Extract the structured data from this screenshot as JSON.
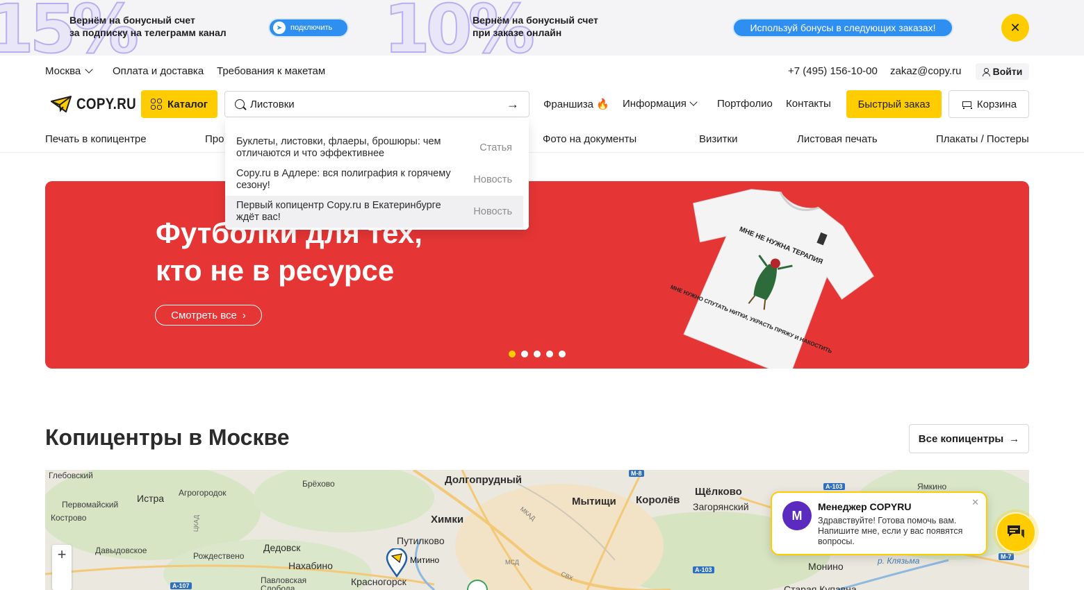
{
  "promo": {
    "big1": "15%",
    "text1_line1": "Вернём на бонусный счет",
    "text1_line2": "за подписку на телеграмм канал",
    "connect_label": "подключить",
    "big2": "10%",
    "text2_line1": "Вернём на бонусный счет",
    "text2_line2": "при заказе онлайн",
    "bonus_label": "Используй бонусы в следующих заказах!",
    "close_glyph": "✕"
  },
  "topbar": {
    "city": "Москва",
    "links": [
      "Оплата и доставка",
      "Требования к макетам"
    ],
    "phone": "+7 (495) 156-10-00",
    "email": "zakaz@copy.ru",
    "login": "Войти"
  },
  "header": {
    "logo": "COPY.RU",
    "catalog": "Каталог",
    "search_value": "Листовки",
    "nav": [
      "Франшиза 🔥",
      "Информация",
      "Портфолио",
      "Контакты"
    ],
    "fast_order": "Быстрый заказ",
    "cart": "Корзина"
  },
  "categories": [
    "Печать в копицентре",
    "Про",
    "Фото на документы",
    "Визитки",
    "Листовая печать",
    "Плакаты / Постеры"
  ],
  "search_results": [
    {
      "title": "Буклеты, листовки, флаеры, брошюры: чем отличаются и что эффективнее",
      "kind": "Статья"
    },
    {
      "title": "Copy.ru в Адлере: вся полиграфия к горячему сезону!",
      "kind": "Новость"
    },
    {
      "title": "Первый копицентр Copy.ru в Екатеринбурге ждёт вас!",
      "kind": "Новость"
    }
  ],
  "hero": {
    "title_line1": "Футболки для тех,",
    "title_line2": "кто не в ресурсе",
    "cta": "Смотреть все",
    "shirt_text1": "МНЕ НЕ НУЖНА ТЕРАПИЯ",
    "shirt_text2": "МНЕ НУЖНО СПУТАТЬ НИТКИ, УКРАСТЬ ПРЯЖУ И НАКОСТИТЬ",
    "slides": 5,
    "active_slide": 1
  },
  "centers": {
    "title": "Копицентры в Москве",
    "all_button": "Все копицентры"
  },
  "map": {
    "labels": [
      "Глебовский",
      "Истра",
      "Агрогородок",
      "Брёхово",
      "Долгопрудный",
      "Мытищи",
      "Королёв",
      "Щёлково",
      "Загорянский",
      "Первомайский",
      "Кострово",
      "Химки",
      "Путилково",
      "Дедовск",
      "Давыдовское",
      "Рождествено",
      "Нахабино",
      "Митино",
      "Красногорск",
      "Павловская Слобода",
      "Ямкино",
      "Монино",
      "Старая Купавна",
      "р. Клязьма"
    ],
    "roads": [
      "М-8",
      "А-103",
      "А-103",
      "М-7",
      "А-107",
      "ЦКАД",
      "МКАД",
      "МСД",
      "СВХ"
    ],
    "zoom_in": "+"
  },
  "chat": {
    "name": "Менеджер COPYRU",
    "message": "Здравствуйте! Готова помочь вам. Напишите мне, если у вас появятся вопросы.",
    "close": "✕"
  },
  "colors": {
    "accent": "#ffcc00",
    "hero_bg": "#e63535",
    "telegram_blue": "#2f8ff0"
  }
}
